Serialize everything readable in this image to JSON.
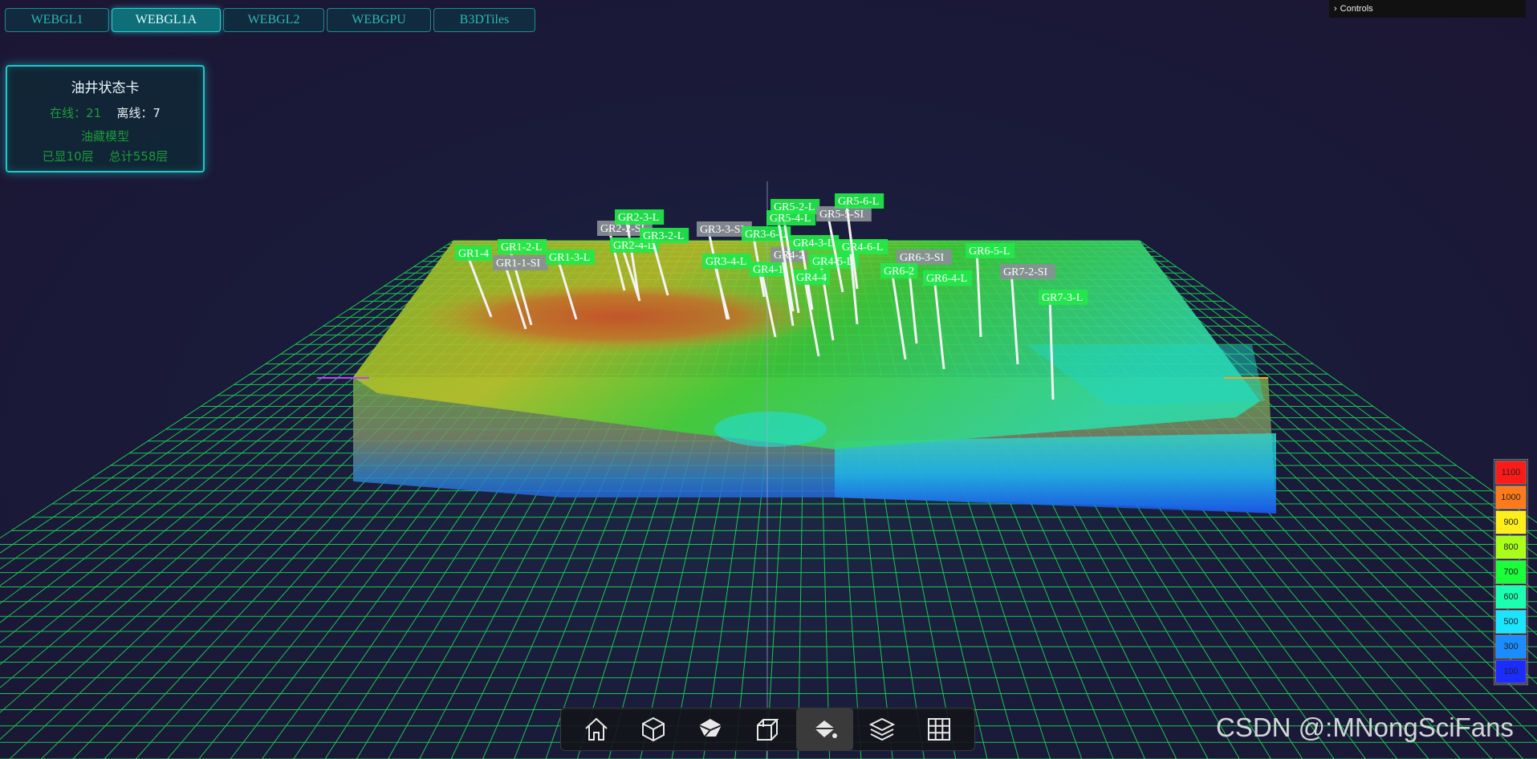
{
  "tabs": [
    {
      "label": "WEBGL1",
      "active": false
    },
    {
      "label": "WEBGL1A",
      "active": true
    },
    {
      "label": "WEBGL2",
      "active": false
    },
    {
      "label": "WEBGPU",
      "active": false
    },
    {
      "label": "B3DTiles",
      "active": false
    }
  ],
  "controls": {
    "label": "Controls",
    "chevron_icon": "chevron-right-icon"
  },
  "status_card": {
    "title": "油井状态卡",
    "online_label": "在线：21",
    "offline_label": "离线：7",
    "model_label": "油藏模型",
    "layers_shown": "已显10层",
    "layers_total": "总计558层"
  },
  "wells": [
    {
      "name": "GR1-4",
      "online": true
    },
    {
      "name": "GR1-2-L",
      "online": true
    },
    {
      "name": "GR1-1-SI",
      "online": false
    },
    {
      "name": "GR1-3-L",
      "online": true
    },
    {
      "name": "GR2-2-SI",
      "online": false
    },
    {
      "name": "GR2-3-L",
      "online": true
    },
    {
      "name": "GR2-4-L",
      "online": true
    },
    {
      "name": "GR3-2-L",
      "online": true
    },
    {
      "name": "GR3-3-SI",
      "online": false
    },
    {
      "name": "GR3-6-L",
      "online": true
    },
    {
      "name": "GR3-4-L",
      "online": true
    },
    {
      "name": "GR4-1",
      "online": true
    },
    {
      "name": "GR4-2",
      "online": false
    },
    {
      "name": "GR4-3-L",
      "online": true
    },
    {
      "name": "GR4-5-L",
      "online": true
    },
    {
      "name": "GR4-4",
      "online": true
    },
    {
      "name": "GR4-6-L",
      "online": true
    },
    {
      "name": "GR5-2-L",
      "online": true
    },
    {
      "name": "GR5-4-L",
      "online": true
    },
    {
      "name": "GR5-5-SI",
      "online": false
    },
    {
      "name": "GR5-6-L",
      "online": true
    },
    {
      "name": "GR6-3-SI",
      "online": false
    },
    {
      "name": "GR6-2",
      "online": true
    },
    {
      "name": "GR6-4-L",
      "online": true
    },
    {
      "name": "GR6-5-L",
      "online": true
    },
    {
      "name": "GR7-2-SI",
      "online": false
    },
    {
      "name": "GR7-3-L",
      "online": true
    }
  ],
  "legend": [
    {
      "value": "1100",
      "color": "#ff1a1a"
    },
    {
      "value": "1000",
      "color": "#ff7a1a"
    },
    {
      "value": "900",
      "color": "#ffee1a"
    },
    {
      "value": "800",
      "color": "#a8ff1a"
    },
    {
      "value": "700",
      "color": "#1aff3a"
    },
    {
      "value": "600",
      "color": "#1affb0"
    },
    {
      "value": "500",
      "color": "#1ae4ff"
    },
    {
      "value": "300",
      "color": "#1a8cff"
    },
    {
      "value": "100",
      "color": "#1a2cff"
    }
  ],
  "toolbar": [
    {
      "icon": "home-icon",
      "active": false
    },
    {
      "icon": "cube-icon",
      "active": false
    },
    {
      "icon": "cube-cut-icon",
      "active": false
    },
    {
      "icon": "cube-outline-icon",
      "active": false
    },
    {
      "icon": "paint-bucket-icon",
      "active": true
    },
    {
      "icon": "layers-icon",
      "active": false
    },
    {
      "icon": "grid-icon",
      "active": false
    }
  ],
  "watermark": "CSDN @:MNongSciFans",
  "colors": {
    "accent": "#1fc9c9",
    "grid": "#1aff5a",
    "online_label": "#22e84a",
    "offline_label": "#8a8f96"
  }
}
